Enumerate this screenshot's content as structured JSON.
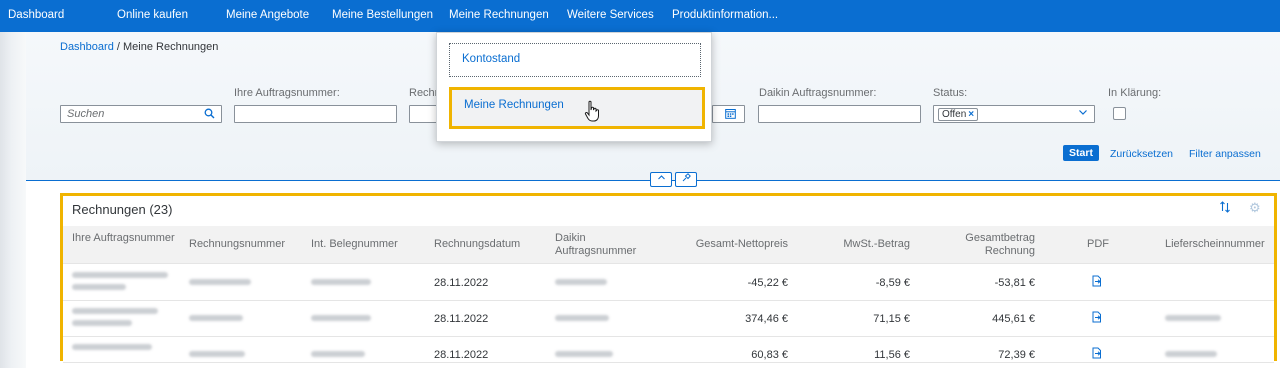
{
  "nav": {
    "items": [
      "Dashboard",
      "Online kaufen",
      "Meine Angebote",
      "Meine Bestellungen",
      "Meine Rechnungen",
      "Weitere Services",
      "Produktinformation..."
    ]
  },
  "breadcrumb": {
    "link": "Dashboard",
    "separator": " / ",
    "current": "Meine Rechnungen"
  },
  "filters": {
    "search_placeholder": "Suchen",
    "labels": {
      "order_number": "Ihre Auftragsnummer:",
      "invoice_number_partial": "Rechnun",
      "daikin_order": "Daikin Auftragsnummer:",
      "status": "Status:",
      "in_clarification": "In Klärung:"
    },
    "status_token": "Offen",
    "start_label": "Start",
    "reset_label": "Zurücksetzen",
    "adjust_label": "Filter anpassen"
  },
  "dropdown": {
    "items": [
      "Kontostand",
      "Meine Rechnungen"
    ],
    "active_index": 1
  },
  "table": {
    "title": "Rechnungen (23)",
    "columns": [
      "Ihre Auftragsnummer",
      "Rechnungsnummer",
      "Int. Belegnummer",
      "Rechnungsdatum",
      "Daikin Auftragsnummer",
      "Gesamt-Nettopreis",
      "MwSt.-Betrag",
      "Gesamtbetrag Rechnung",
      "PDF",
      "Lieferscheinnummer"
    ],
    "rows": [
      {
        "date": "28.11.2022",
        "net": "-45,22 €",
        "vat": "-8,59 €",
        "total": "-53,81 €"
      },
      {
        "date": "28.11.2022",
        "net": "374,46 €",
        "vat": "71,15 €",
        "total": "445,61 €"
      },
      {
        "date": "28.11.2022",
        "net": "60,83 €",
        "vat": "11,56 €",
        "total": "72,39 €"
      }
    ]
  },
  "colors": {
    "primary": "#0a6ed1",
    "highlight": "#f0b400"
  }
}
